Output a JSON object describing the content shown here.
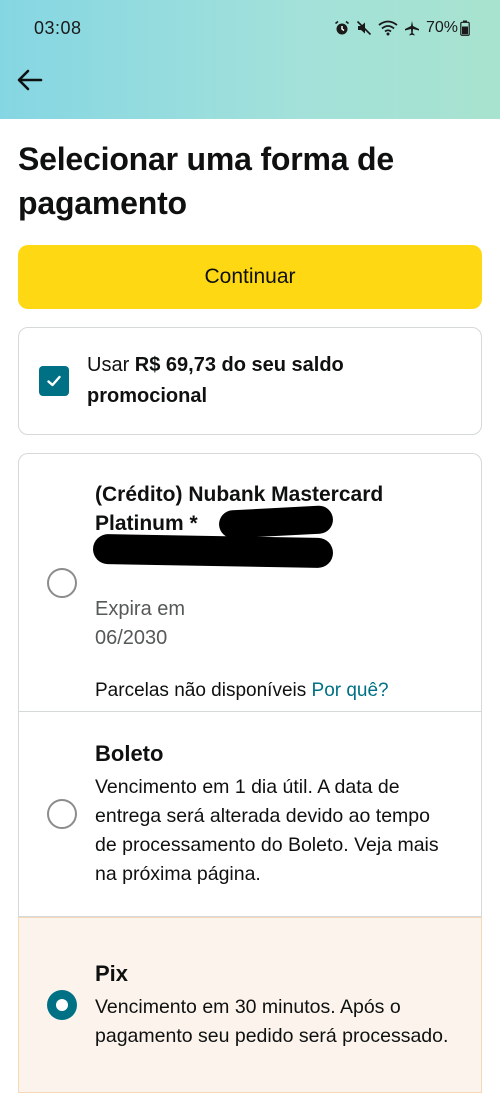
{
  "status_bar": {
    "time": "03:08",
    "battery": "70%"
  },
  "header": {
    "back_icon": "arrow-left-icon"
  },
  "page": {
    "title": "Selecionar uma forma de pagamento",
    "continue_label": "Continuar"
  },
  "balance": {
    "prefix": "Usar ",
    "amount": "R$ 69,73 do seu saldo promocional",
    "checked": true
  },
  "payment_methods": {
    "card": {
      "name": "(Crédito) Nubank Mastercard Platinum *",
      "expiry_label": "Expira em",
      "expiry_date": "06/2030",
      "installments_text": "Parcelas não disponíveis ",
      "why_link": "Por quê?",
      "selected": false
    },
    "boleto": {
      "title": "Boleto",
      "description": "Vencimento em 1 dia útil. A data de entrega será alterada devido ao tempo de processamento do Boleto. Veja mais na próxima página.",
      "selected": false
    },
    "pix": {
      "title": "Pix",
      "description": "Vencimento em 30 minutos. Após o pagamento seu pedido será processado.",
      "selected": true
    }
  },
  "colors": {
    "accent": "#007185",
    "button": "#ffd814",
    "selected_bg": "#fcf4ec"
  }
}
